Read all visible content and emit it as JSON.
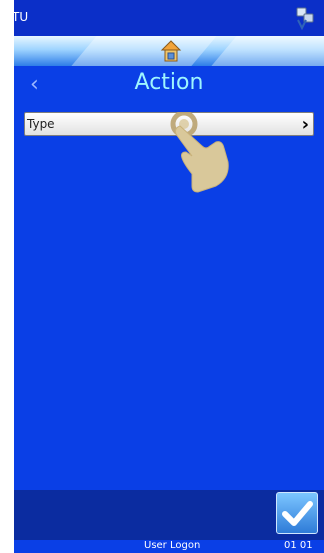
{
  "topbar": {
    "left_text": "TU",
    "right_icon": "network-icon"
  },
  "banner": {
    "icon": "home-icon"
  },
  "header": {
    "title": "Action",
    "back_icon": "chevron-left-icon"
  },
  "list": {
    "items": [
      {
        "label": "Type",
        "icon": "chevron-right-icon"
      }
    ]
  },
  "overlay": {
    "icon": "hand-pointer-icon"
  },
  "footer": {
    "ok_icon": "checkmark-icon"
  },
  "status": {
    "user": "User Logon",
    "time": "01 01"
  },
  "colors": {
    "background": "#0a3fe6",
    "title": "#9ef5ff"
  }
}
